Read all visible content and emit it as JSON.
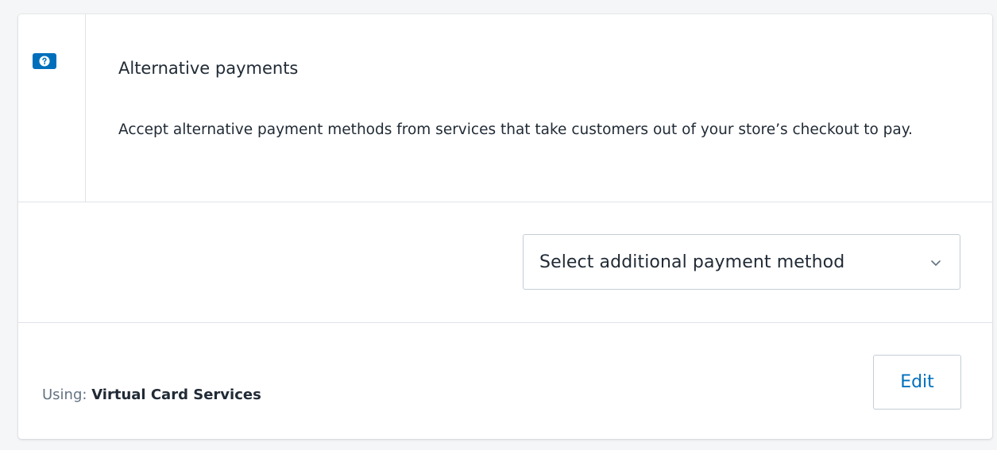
{
  "header": {
    "help_icon": "question-circle-icon",
    "title": "Alternative payments",
    "description": "Accept alternative payment methods from services that take customers out of your store’s checkout to pay."
  },
  "payment_select": {
    "selected_label": "Select additional payment method",
    "icon": "chevron-down-icon"
  },
  "provider": {
    "using_label": "Using:",
    "using_value": "Virtual Card Services",
    "edit_label": "Edit"
  },
  "colors": {
    "accent": "#006fbb",
    "background": "#f4f6f8",
    "border": "#dfe3e8"
  }
}
